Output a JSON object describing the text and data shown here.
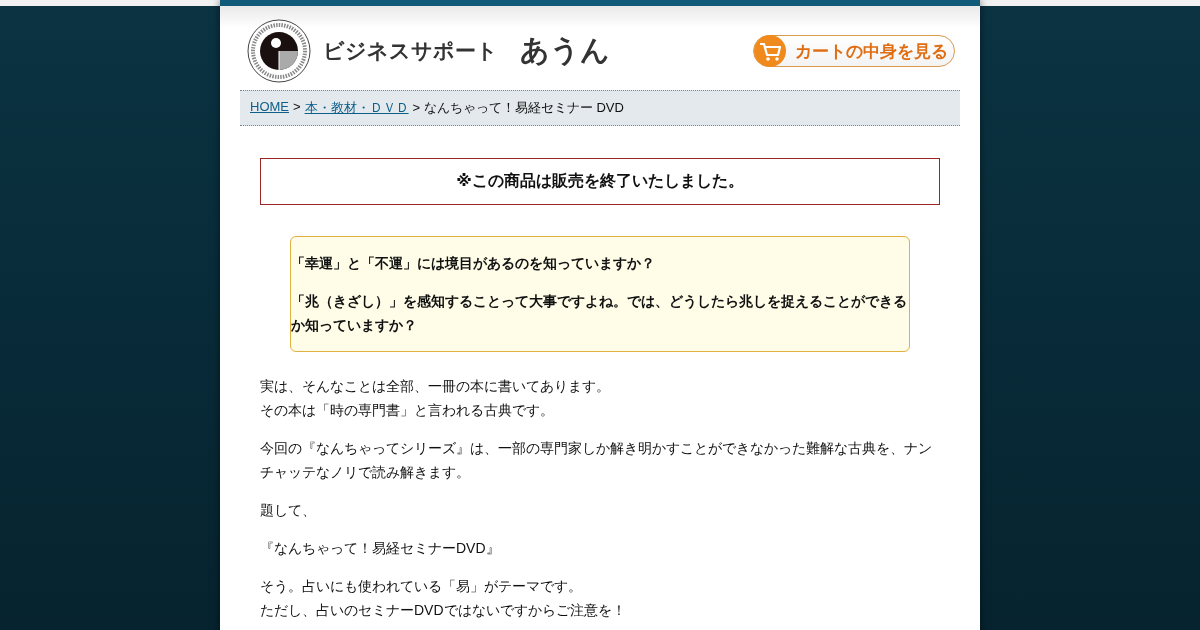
{
  "header": {
    "site_name": "ビジネスサポート",
    "site_name_strong": "あうん",
    "cart_button": "カートの中身を見る"
  },
  "breadcrumb": [
    {
      "label": "HOME",
      "link": true
    },
    {
      "label": ">",
      "link": false
    },
    {
      "label": "本・教材・ＤＶＤ",
      "link": true
    },
    {
      "label": "> なんちゃって！易経セミナー DVD",
      "link": false
    }
  ],
  "notice": "※この商品は販売を終了いたしました。",
  "highlight": [
    "「幸運」と「不運」には境目があるのを知っていますか？",
    "「兆（きざし）」を感知することって大事ですよね。では、どうしたら兆しを捉えることができるか知っていますか？"
  ],
  "paragraphs": [
    [
      "実は、そんなことは全部、一冊の本に書いてあります。",
      "その本は「時の専門書」と言われる古典です。"
    ],
    [
      "今回の『なんちゃってシリーズ』は、一部の専門家しか解き明かすことができなかった難解な古典を、ナンチャッテなノリで読み解きます。"
    ],
    [
      "題して、"
    ],
    [
      "『なんちゃって！易経セミナーDVD』"
    ],
    [
      "そう。占いにも使われている「易」がテーマです。",
      "ただし、占いのセミナーDVDではないですからご注意を！"
    ]
  ]
}
